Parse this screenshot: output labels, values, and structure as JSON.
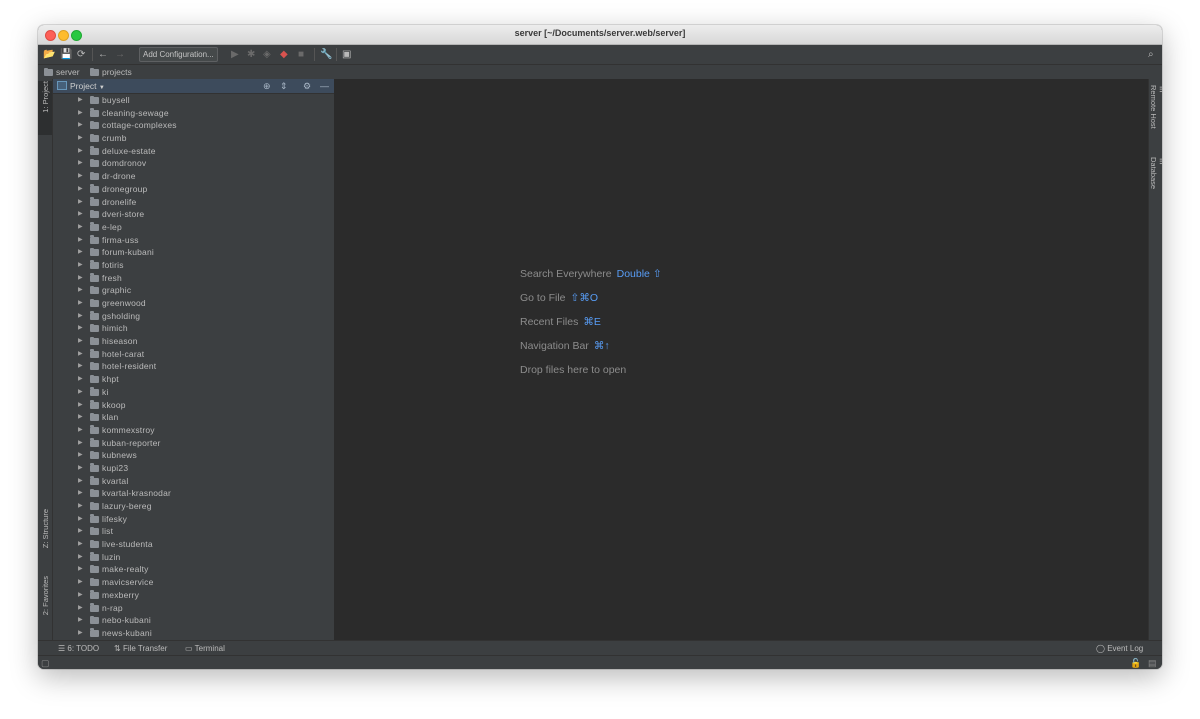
{
  "window": {
    "title": "server [~/Documents/server.web/server]"
  },
  "toolbar": {
    "add_configuration_label": "Add Configuration..."
  },
  "breadcrumb": {
    "items": [
      "server",
      "projects"
    ]
  },
  "left_strip": {
    "project_tab": "1: Project",
    "structure_tab": "Z: Structure",
    "favorites_tab": "2: Favorites"
  },
  "project_panel": {
    "title": "Project",
    "folders": [
      "buysell",
      "cleaning-sewage",
      "cottage-complexes",
      "crumb",
      "deluxe-estate",
      "domdronov",
      "dr-drone",
      "dronegroup",
      "dronelife",
      "dveri-store",
      "e-lep",
      "firma-uss",
      "forum-kubani",
      "fotiris",
      "fresh",
      "graphic",
      "greenwood",
      "gsholding",
      "himich",
      "hiseason",
      "hotel-carat",
      "hotel-resident",
      "khpt",
      "ki",
      "kkoop",
      "klan",
      "kommexstroy",
      "kuban-reporter",
      "kubnews",
      "kupi23",
      "kvartal",
      "kvartal-krasnodar",
      "lazury-bereg",
      "lifesky",
      "list",
      "live-studenta",
      "luzin",
      "make-realty",
      "mavicservice",
      "mexberry",
      "n-rap",
      "nebo-kubani",
      "news-kubani"
    ]
  },
  "editor": {
    "hints": [
      {
        "label": "Search Everywhere",
        "shortcut": "Double ⇧"
      },
      {
        "label": "Go to File",
        "shortcut": "⇧⌘O"
      },
      {
        "label": "Recent Files",
        "shortcut": "⌘E"
      },
      {
        "label": "Navigation Bar",
        "shortcut": "⌘↑"
      },
      {
        "label": "Drop files here to open",
        "shortcut": ""
      }
    ]
  },
  "right_strip": {
    "remote_host_tab": "Remote Host",
    "database_tab": "Database"
  },
  "bottom_bar": {
    "todo": "6: TODO",
    "file_transfer": "File Transfer",
    "terminal": "Terminal",
    "event_log": "Event Log"
  },
  "colors": {
    "accent": "#589df6",
    "editor_bg": "#2b2b2b",
    "panel_bg": "#3c3f41",
    "panel_header": "#3d4b5c"
  }
}
